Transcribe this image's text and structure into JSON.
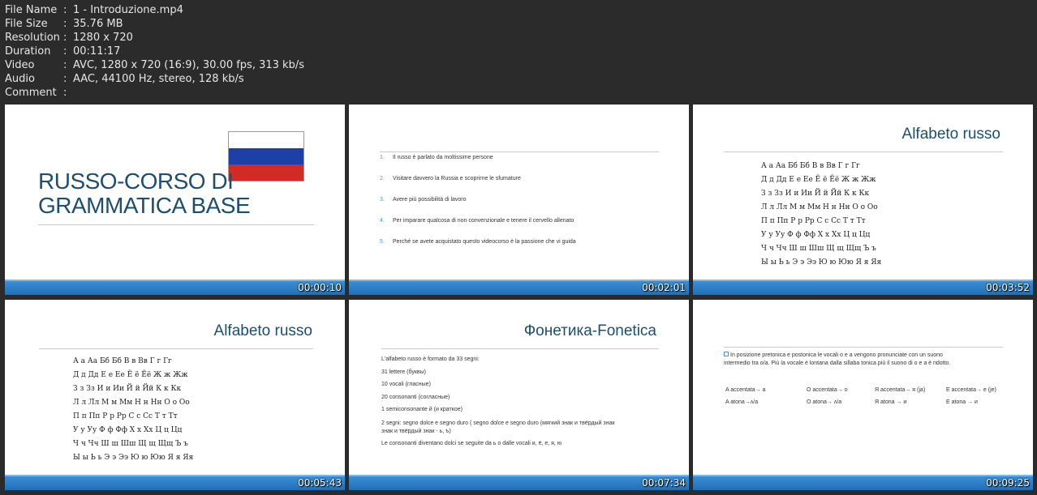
{
  "meta": {
    "rows": [
      {
        "key": "File Name",
        "value": "1 - Introduzione.mp4"
      },
      {
        "key": "File Size",
        "value": "35.76 MB"
      },
      {
        "key": "Resolution",
        "value": "1280 x 720"
      },
      {
        "key": "Duration",
        "value": "00:11:17"
      },
      {
        "key": "Video",
        "value": "AVC, 1280 x 720 (16:9), 30.00 fps, 313 kb/s"
      },
      {
        "key": "Audio",
        "value": "AAC, 44100 Hz, stereo, 128 kb/s"
      },
      {
        "key": "Comment",
        "value": ""
      }
    ],
    "separator": ":"
  },
  "thumbs": {
    "t1": {
      "timestamp": "00:00:10",
      "title_line1": "RUSSO-CORSO DI",
      "title_line2": "GRAMMATICA BASE"
    },
    "t2": {
      "timestamp": "00:02:01",
      "items": [
        {
          "num": "1.",
          "text": "Il russo è parlato da moltissime persone"
        },
        {
          "num": "2.",
          "text": "Visitare davvero la Russia e scoprirne le sfumature"
        },
        {
          "num": "3.",
          "text": "Avere più possibilità di lavoro"
        },
        {
          "num": "4.",
          "text": "Per imparare qualcosa di non convenzionale e tenere il cervello allenato"
        },
        {
          "num": "5.",
          "text": "Perché se avete acquistato questo videocorso è la passione che vi guida"
        }
      ]
    },
    "t3": {
      "timestamp": "00:03:52",
      "heading": "Alfabeto russo"
    },
    "t4": {
      "timestamp": "00:05:43",
      "heading": "Alfabeto russo"
    },
    "t5": {
      "timestamp": "00:07:34",
      "heading": "Фонетика-Fonetica",
      "lines": [
        "L'alfabeto russo è formato da 33 segni:",
        "31 lettere (буквы)",
        "10 vocali (гласные)",
        "20 consonanti (согласные)",
        "1 semiconsonante й (и краткое)",
        "2 segni: segno dolce e segno duro ( segno dolce e segno duro (мягкий знак и твёрдый знак",
        "знак и твёрдый знак - ь, ъ)",
        "Le consonanti diventano dolci se seguite da ь o dalle vocali и, ё, е, я, ю"
      ]
    },
    "t6": {
      "timestamp": "00:09:25",
      "para_line1": "In posizione pretonica e postonica le vocali o e a vengono pronunciate con un suono",
      "para_line2": "intermedio tra o/a. Più la vocale è lontana dalla sillaba tonica più il suono di o e a è ridotto.",
      "c1a": "A accentata→ a",
      "c1b": "A atona→ʌ/a",
      "c2a": "O accentata→ o",
      "c2b": "O atona→ ʌ/a",
      "c3a": "Я accentata→ я (ja)",
      "c3b": "Я atona → и",
      "c4a": "E accentata→ e (je)",
      "c4b": "E atona → и"
    }
  },
  "alphabet": [
    "А а  Аа Бб  Бб  В в  Вв  Г г  Гг",
    "Д д  Дд Е е  Ее  Ё ё  Ёё  Ж ж  Жж",
    "З з  Зз  И и  Ии  Й й  Йй  К к  Кк",
    "Л л  Лл  М м  Мм  Н н  Нн  О о  Оо",
    "П п  Пп  Р р  Рр  С с  Сс  Т т  Тт",
    "У у  Уу  Ф ф  Фф  Х х  Хх  Ц ц  Цц",
    "Ч ч  Чч  Ш ш  Шш   Щ щ  Щщ  Ъ ъ",
    "Ы ы  Ь ь  Э э  Ээ  Ю ю  Юю  Я я  Яя"
  ]
}
